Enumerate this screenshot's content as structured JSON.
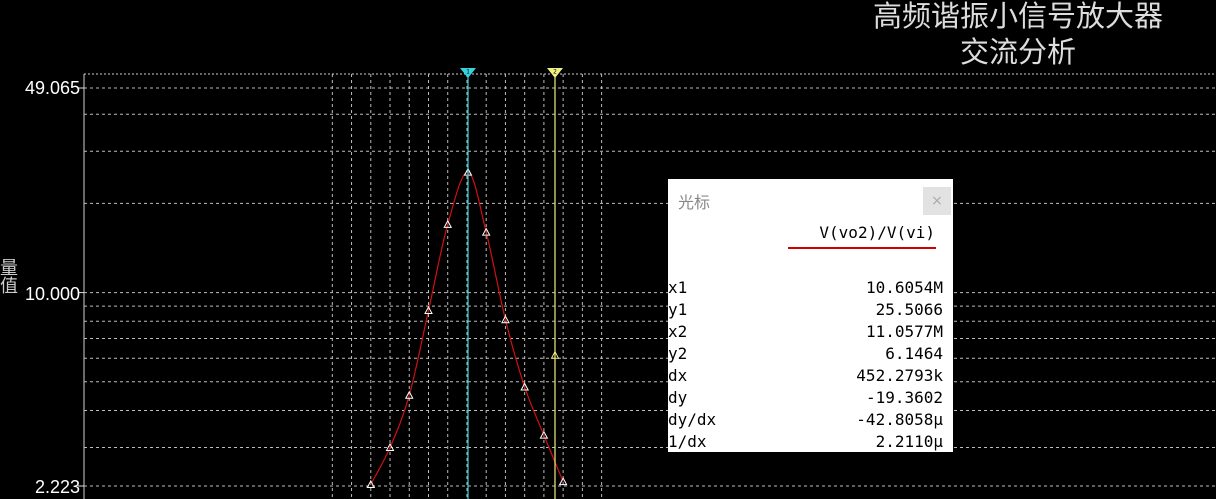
{
  "header": {
    "title_line1": "高频谐振小信号放大器",
    "title_line2": "交流分析"
  },
  "chart_data": {
    "type": "line",
    "title": "高频谐振小信号放大器 交流分析",
    "ylabel": "量值",
    "yscale": "log",
    "ylim": [
      2.223,
      49.065
    ],
    "yticks": [
      "49.065",
      "10.000",
      "2.223"
    ],
    "xunit": "Hz",
    "series": [
      {
        "name": "V(vo2)/V(vi)",
        "color": "#d01010",
        "x": [
          10100000.0,
          10200000.0,
          10300000.0,
          10400000.0,
          10500000.0,
          10605400.0,
          10700000.0,
          10800000.0,
          10900000.0,
          11000000.0,
          11100000.0
        ],
        "y": [
          2.25,
          3.0,
          4.5,
          8.7,
          17.0,
          25.5066,
          16.0,
          8.1,
          4.8,
          3.3,
          2.3
        ]
      }
    ],
    "cursors": [
      {
        "name": "x1",
        "x": 10605400.0,
        "color": "#33d6e0",
        "label_marker": "1"
      },
      {
        "name": "x2",
        "x": 11057700.0,
        "color": "#f0f080",
        "label_marker": "2"
      }
    ]
  },
  "cursor_panel": {
    "title": "光标",
    "close_label": "×",
    "trace_name": "V(vo2)/V(vi)",
    "rows": [
      {
        "key": "x1",
        "value": "10.6054M"
      },
      {
        "key": "y1",
        "value": "25.5066"
      },
      {
        "key": "x2",
        "value": "11.0577M"
      },
      {
        "key": "y2",
        "value": "6.1464"
      },
      {
        "key": "dx",
        "value": "452.2793k"
      },
      {
        "key": "dy",
        "value": "-19.3602"
      },
      {
        "key": "dy/dx",
        "value": "-42.8058μ"
      },
      {
        "key": "1/dx",
        "value": "2.2110μ"
      }
    ]
  }
}
